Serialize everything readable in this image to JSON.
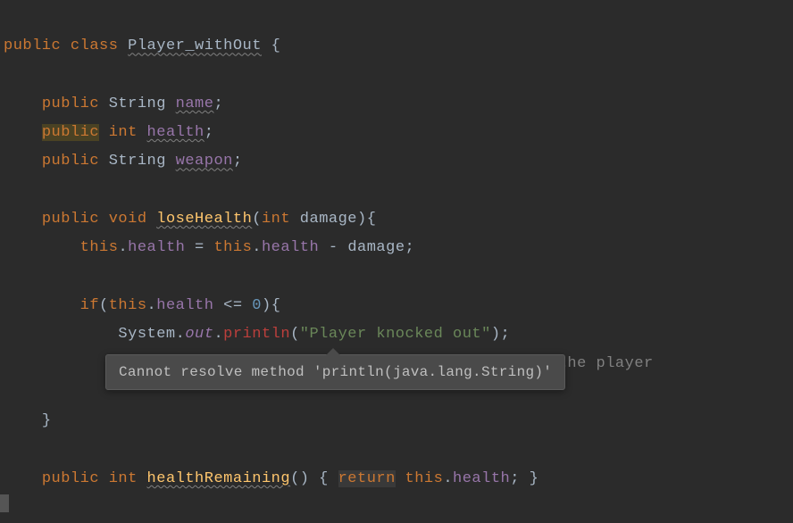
{
  "code": {
    "line1": {
      "kw_public": "public",
      "kw_class": "class",
      "class_name": "Player_withOut",
      "brace": "{"
    },
    "line3": {
      "kw_public": "public",
      "type": "String",
      "name": "name",
      "semi": ";"
    },
    "line4": {
      "kw_public": "public",
      "type": "int",
      "name": "health",
      "semi": ";"
    },
    "line5": {
      "kw_public": "public",
      "type": "String",
      "name": "weapon",
      "semi": ";"
    },
    "line7": {
      "kw_public": "public",
      "kw_void": "void",
      "method": "loseHealth",
      "paren_o": "(",
      "param_type": "int",
      "param_name": "damage",
      "paren_c": ")",
      "brace": "{"
    },
    "line8": {
      "this1": "this",
      "dot1": ".",
      "field1": "health",
      "eq": " = ",
      "this2": "this",
      "dot2": ".",
      "field2": "health",
      "minus": " - ",
      "var": "damage",
      "semi": ";"
    },
    "line10": {
      "kw_if": "if",
      "paren_o": "(",
      "this": "this",
      "dot": ".",
      "field": "health",
      "op": " <= ",
      "num": "0",
      "paren_c": ")",
      "brace": "{"
    },
    "line11": {
      "sys": "System",
      "dot1": ".",
      "out": "out",
      "dot2": ".",
      "println": "println",
      "paren_o": "(",
      "str": "\"Player knocked out\"",
      "paren_c": ")",
      "semi": ";"
    },
    "line12": {
      "tail": " for the player"
    },
    "line14": {
      "brace": "}"
    },
    "line16": {
      "kw_public": "public",
      "type": "int",
      "method": "healthRemaining",
      "paren_o": "(",
      "paren_c": ")",
      "brace_o": " { ",
      "kw_return": "return",
      "sp": " ",
      "this": "this",
      "dot": ".",
      "field": "health",
      "semi": ";",
      "brace_c": " }"
    }
  },
  "tooltip": {
    "text": "Cannot resolve method 'println(java.lang.String)'"
  }
}
